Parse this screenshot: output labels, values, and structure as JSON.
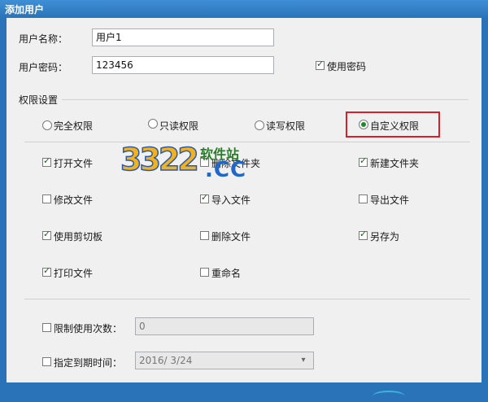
{
  "window": {
    "title": "添加用户"
  },
  "user": {
    "name_label": "用户名称：",
    "name_value": "用户1",
    "password_label": "用户密码：",
    "password_value": "123456",
    "use_password_label": "使用密码",
    "use_password_checked": true
  },
  "permissions": {
    "group_title": "权限设置",
    "modes": [
      {
        "label": "完全权限",
        "selected": false
      },
      {
        "label": "只读权限",
        "selected": false
      },
      {
        "label": "读写权限",
        "selected": false
      },
      {
        "label": "自定义权限",
        "selected": true
      }
    ],
    "options": [
      {
        "label": "打开文件",
        "checked": true
      },
      {
        "label": "删除文件夹",
        "checked": false
      },
      {
        "label": "新建文件夹",
        "checked": true
      },
      {
        "label": "修改文件",
        "checked": false
      },
      {
        "label": "导入文件",
        "checked": true
      },
      {
        "label": "导出文件",
        "checked": false
      },
      {
        "label": "使用剪切板",
        "checked": true
      },
      {
        "label": "删除文件",
        "checked": false
      },
      {
        "label": "另存为",
        "checked": true
      },
      {
        "label": "打印文件",
        "checked": true
      },
      {
        "label": "重命名",
        "checked": false
      }
    ]
  },
  "limits": {
    "limit_count_label": "限制使用次数：",
    "limit_count_checked": false,
    "limit_count_value": "0",
    "expire_label": "指定到期时间：",
    "expire_checked": false,
    "expire_value": "2016/  3/24"
  },
  "watermark": {
    "digits": "3322",
    "site": "软件站",
    "suffix": ".CC"
  },
  "colors": {
    "titlebar": "#2a73b9",
    "client_bg": "#f0f0f0",
    "highlight": "#d6202a",
    "check": "#1e5f1e"
  }
}
